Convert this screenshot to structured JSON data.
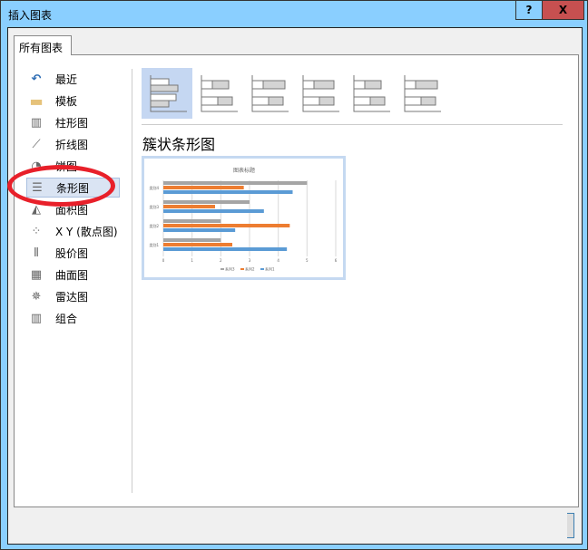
{
  "window": {
    "title": "插入图表",
    "help_label": "?",
    "close_label": "X"
  },
  "tab": {
    "label": "所有图表"
  },
  "sidebar": {
    "items": [
      {
        "label": "最近",
        "icon": "recent-icon"
      },
      {
        "label": "模板",
        "icon": "folder-icon"
      },
      {
        "label": "柱形图",
        "icon": "column-chart-icon"
      },
      {
        "label": "折线图",
        "icon": "line-chart-icon"
      },
      {
        "label": "饼图",
        "icon": "pie-chart-icon"
      },
      {
        "label": "条形图",
        "icon": "bar-chart-icon",
        "selected": true
      },
      {
        "label": "面积图",
        "icon": "area-chart-icon"
      },
      {
        "label": "X Y (散点图)",
        "icon": "scatter-chart-icon"
      },
      {
        "label": "股价图",
        "icon": "stock-chart-icon"
      },
      {
        "label": "曲面图",
        "icon": "surface-chart-icon"
      },
      {
        "label": "雷达图",
        "icon": "radar-chart-icon"
      },
      {
        "label": "组合",
        "icon": "combo-chart-icon"
      }
    ]
  },
  "subtypes": [
    "clustered-bar",
    "stacked-bar",
    "100-stacked-bar",
    "3d-clustered-bar",
    "3d-stacked-bar",
    "3d-100-stacked-bar"
  ],
  "selected_subtype_name": "簇状条形图",
  "colors": {
    "series1": "#5b9bd5",
    "series2": "#ed7d31",
    "series3": "#a5a5a5",
    "highlight": "#e8202a"
  },
  "chart_data": {
    "type": "bar",
    "title": "图表标题",
    "categories": [
      "类别1",
      "类别2",
      "类别3",
      "类别4"
    ],
    "series": [
      {
        "name": "系列1",
        "values": [
          4.3,
          2.5,
          3.5,
          4.5
        ]
      },
      {
        "name": "系列2",
        "values": [
          2.4,
          4.4,
          1.8,
          2.8
        ]
      },
      {
        "name": "系列3",
        "values": [
          2,
          2,
          3,
          5
        ]
      }
    ],
    "xlim": [
      0,
      6
    ],
    "ticks": [
      "0",
      "1",
      "2",
      "3",
      "4",
      "5",
      "6"
    ],
    "legend": "bottom",
    "grid": true
  }
}
